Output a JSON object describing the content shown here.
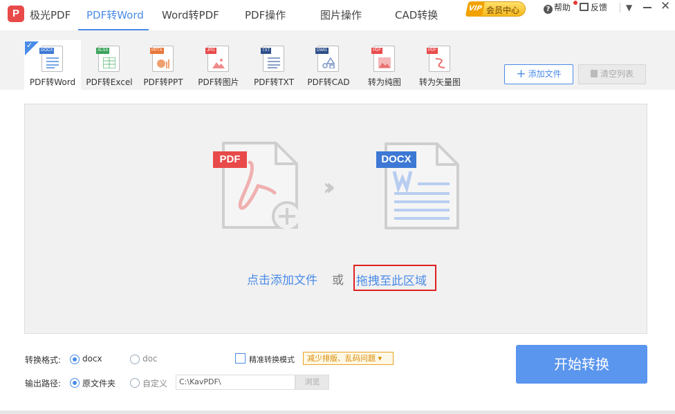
{
  "nav": {
    "logo": "P",
    "app_name": "极光PDF",
    "tabs": [
      "PDF转Word",
      "Word转PDF",
      "PDF操作",
      "图片操作",
      "CAD转换"
    ],
    "active_tab": "PDF转Word"
  },
  "header": {
    "vip_badge": "VIP",
    "vip_label": "会员中心",
    "help": "帮助",
    "feedback": "反馈"
  },
  "tools": [
    {
      "label": "PDF转Word",
      "tag": "DOCX",
      "color": "#3d78d4"
    },
    {
      "label": "PDF转Excel",
      "tag": "XLSX",
      "color": "#3aa35a"
    },
    {
      "label": "PDF转PPT",
      "tag": "PPTX",
      "color": "#e8763a"
    },
    {
      "label": "PDF转图片",
      "tag": "JPG",
      "color": "#e84a4a"
    },
    {
      "label": "PDF转TXT",
      "tag": "TXT",
      "color": "#2e4f8a"
    },
    {
      "label": "PDF转CAD",
      "tag": "DWG",
      "color": "#2e4f8a"
    },
    {
      "label": "转为纯图",
      "tag": "PDF",
      "color": "#e84a4a"
    },
    {
      "label": "转为矢量图",
      "tag": "PDF",
      "color": "#e84a4a"
    }
  ],
  "toolbar": {
    "add_file": "添加文件",
    "clear_list": "清空列表"
  },
  "drop": {
    "pdf_tag": "PDF",
    "docx_tag": "DOCX",
    "click_add": "点击添加文件",
    "or": "或",
    "drag_here": "拖拽至此区域"
  },
  "settings": {
    "format_label": "转换格式:",
    "format_options": [
      "docx",
      "doc"
    ],
    "format_selected": "docx",
    "precise_mode": "精准转换模式",
    "tip": "减少排版、乱码问题",
    "output_label": "输出路径:",
    "output_options": [
      "原文件夹",
      "自定义"
    ],
    "output_selected": "原文件夹",
    "path": "C:\\KavPDF\\",
    "browse": "浏览",
    "start": "开始转换"
  },
  "colors": {
    "accent": "#4a8be8",
    "brand_red": "#e84a4a",
    "highlight_border": "#e02020"
  }
}
